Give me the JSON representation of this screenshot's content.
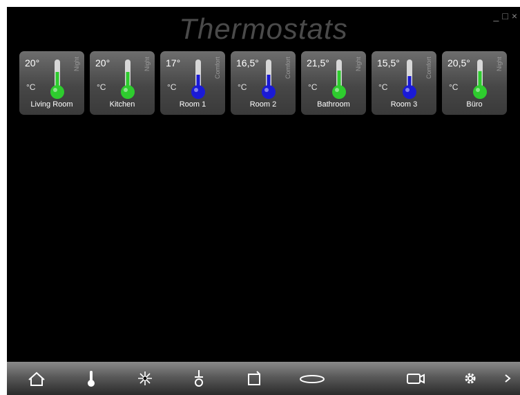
{
  "app": {
    "title": "Thermostats"
  },
  "window_controls": {
    "minimize": "_",
    "maximize": "□",
    "close": "×"
  },
  "thermostats": [
    {
      "name": "Living Room",
      "temp": "20°",
      "unit": "°C",
      "mode": "Night",
      "level": 0.55,
      "color": "#2ecc2e"
    },
    {
      "name": "Kitchen",
      "temp": "20°",
      "unit": "°C",
      "mode": "Night",
      "level": 0.55,
      "color": "#2ecc2e"
    },
    {
      "name": "Room 1",
      "temp": "17°",
      "unit": "°C",
      "mode": "Comfort",
      "level": 0.45,
      "color": "#1a1ad6"
    },
    {
      "name": "Room 2",
      "temp": "16,5°",
      "unit": "°C",
      "mode": "Comfort",
      "level": 0.45,
      "color": "#1a1ad6"
    },
    {
      "name": "Bathroom",
      "temp": "21,5°",
      "unit": "°C",
      "mode": "Night",
      "level": 0.6,
      "color": "#2ecc2e"
    },
    {
      "name": "Room 3",
      "temp": "15,5°",
      "unit": "°C",
      "mode": "Comfort",
      "level": 0.4,
      "color": "#1a1ad6"
    },
    {
      "name": "Büro",
      "temp": "20,5°",
      "unit": "°C",
      "mode": "Night",
      "level": 0.58,
      "color": "#2ecc2e"
    }
  ],
  "toolbar": {
    "items": [
      "home-icon",
      "thermometer-icon",
      "light-icon",
      "plug-icon",
      "window-icon",
      "blinds-icon",
      "camera-icon",
      "gear-icon",
      "chevron-right-icon"
    ]
  }
}
